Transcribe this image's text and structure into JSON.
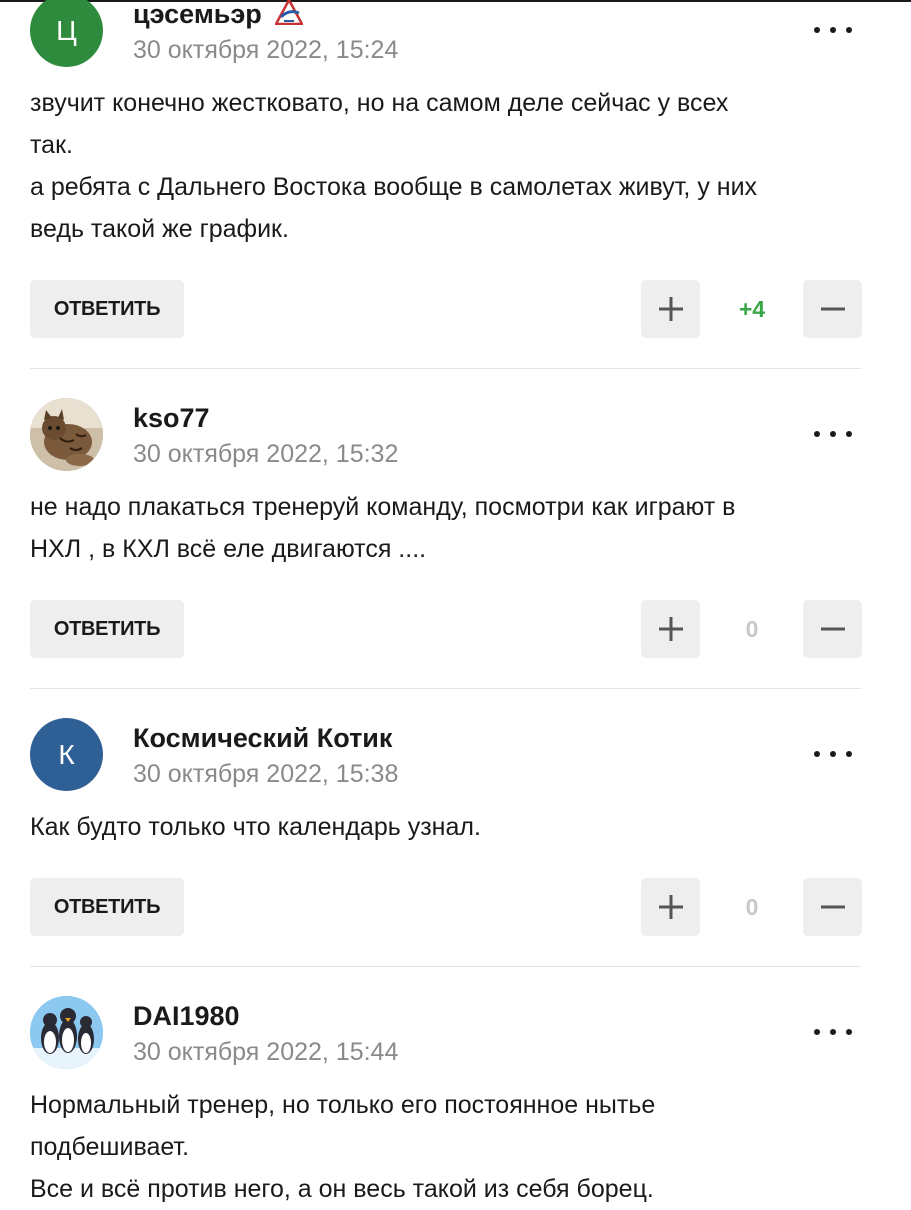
{
  "comments": [
    {
      "author": "цэсемьэр",
      "avatar_letter": "Ц",
      "avatar_color": "#2e8b3d",
      "has_badge": true,
      "date": "30 октября 2022, 15:24",
      "lines": [
        "звучит конечно жестковато, но на самом деле сейчас у всех",
        "так.",
        "а ребята с Дальнего Востока вообще в самолетах живут, у них",
        "ведь такой же график."
      ],
      "reply_label": "ОТВЕТИТЬ",
      "score": "+4",
      "score_color": "#3aa648"
    },
    {
      "author": "kso77",
      "avatar_image": "cat-photo",
      "date": "30 октября 2022, 15:32",
      "lines": [
        "не надо плакаться тренеруй команду, посмотри как играют в",
        "НХЛ , в КХЛ всё еле двигаются ...."
      ],
      "reply_label": "ОТВЕТИТЬ",
      "score": "0",
      "score_color": "#c8c8c8"
    },
    {
      "author": "Космический Котик",
      "avatar_letter": "К",
      "avatar_color": "#2e5f95",
      "date": "30 октября 2022, 15:38",
      "lines": [
        "Как будто только что календарь узнал."
      ],
      "reply_label": "ОТВЕТИТЬ",
      "score": "0",
      "score_color": "#c8c8c8"
    },
    {
      "author": "DAI1980",
      "avatar_image": "penguins-cartoon",
      "date": "30 октября 2022, 15:44",
      "lines": [
        "Нормальный тренер, но только его постоянное нытье",
        "подбешивает.",
        "Все и всё против него, а он весь такой из себя борец."
      ]
    }
  ],
  "icons": {
    "more": "more-dots-icon",
    "upvote": "plus-icon",
    "downvote": "minus-icon",
    "badge": "team-logo-badge-icon"
  }
}
